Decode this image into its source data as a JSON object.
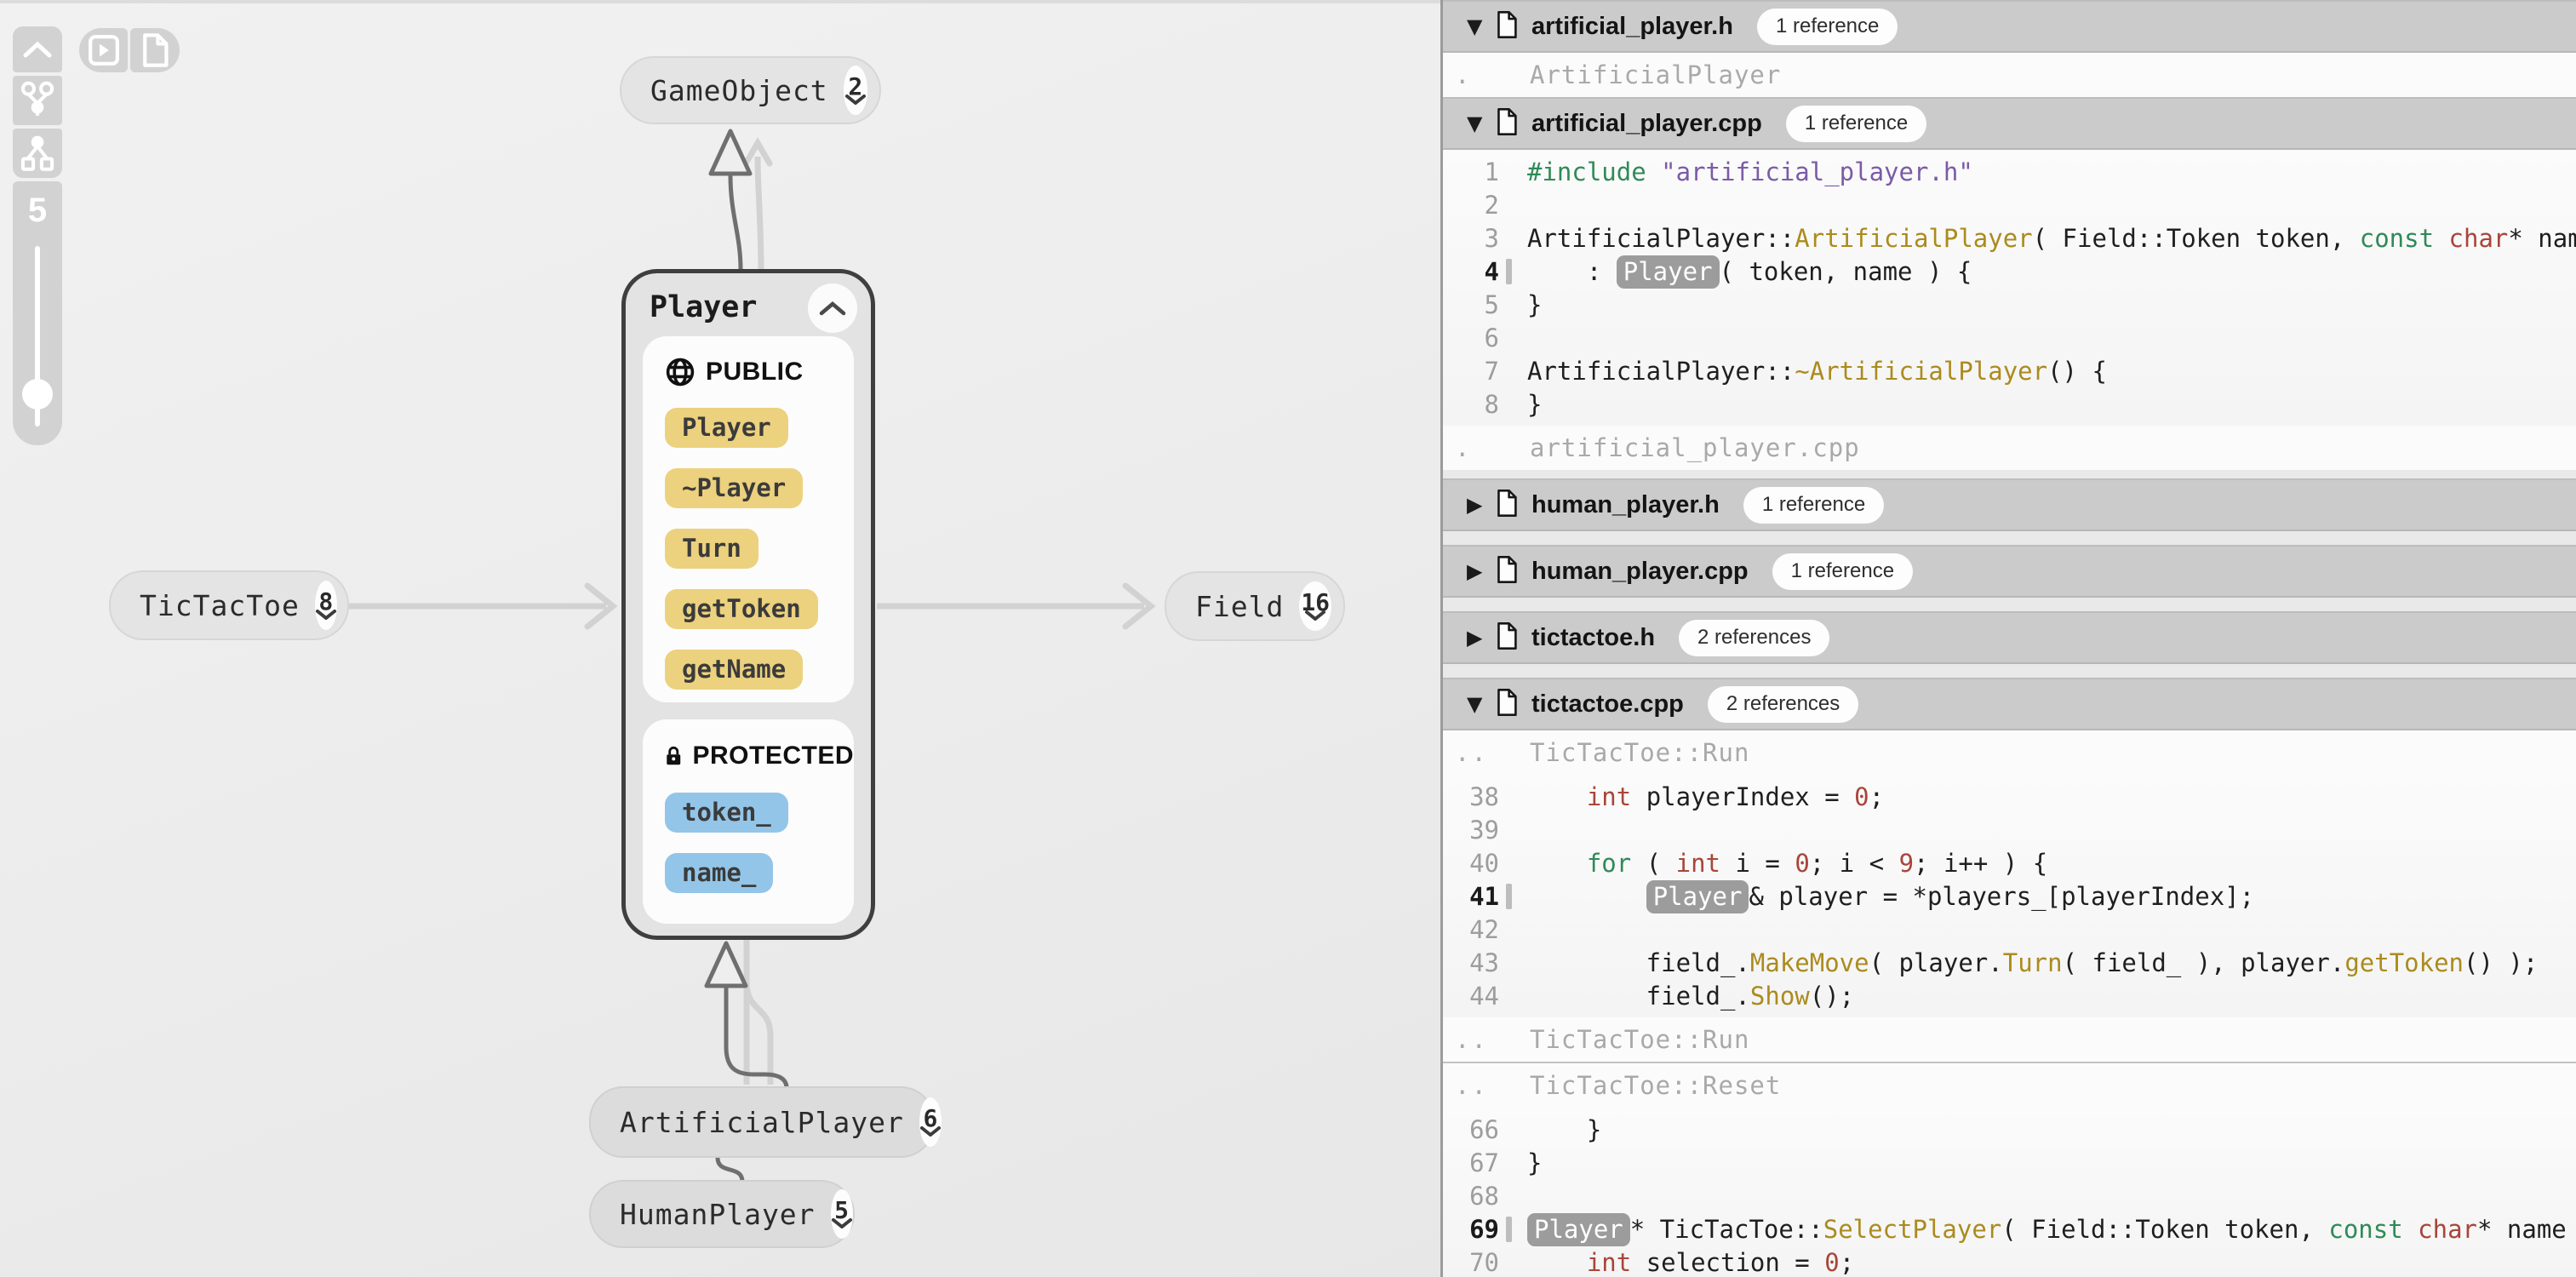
{
  "toolbar": {
    "slider_value": "5",
    "collapse_graph_tooltip": "collapse-all",
    "buttons": [
      "graph-collapse",
      "graph-view",
      "hierarchy-view",
      "custom-trail",
      "file-trail"
    ]
  },
  "colors": {
    "kw": "#2f8a57",
    "ty": "#a8453a",
    "str": "#7b5ba6",
    "fn": "#ab8b1e",
    "num": "#a8453a",
    "p": "#1f1f1f",
    "hl_bg": "#9c9c9c",
    "yellow_pill": "#ecd17e",
    "blue_pill": "#93c5e8",
    "edge_light": "#d2d2d2",
    "edge_dark": "#6f6f6f",
    "header_row": "#cbcbcb"
  },
  "graph": {
    "nodes": {
      "game_object": {
        "label": "GameObject",
        "count": "2"
      },
      "tictactoe": {
        "label": "TicTacToe",
        "count": "8"
      },
      "field": {
        "label": "Field",
        "count": "16"
      },
      "artificial_player": {
        "label": "ArtificialPlayer",
        "count": "6"
      },
      "human_player": {
        "label": "HumanPlayer",
        "count": "5"
      },
      "player": {
        "label": "Player",
        "sections": [
          {
            "icon": "globe",
            "heading": "PUBLIC",
            "pill_color": "#ecd17e",
            "members": [
              "Player",
              "~Player",
              "Turn",
              "getToken",
              "getName"
            ]
          },
          {
            "icon": "lock",
            "heading": "PROTECTED",
            "pill_color": "#93c5e8",
            "members": [
              "token_",
              "name_"
            ]
          }
        ]
      }
    }
  },
  "code_panel": {
    "sections": [
      {
        "type": "file",
        "name": "artificial_player.h",
        "badge": "1 reference",
        "expanded": true,
        "gap": ""
      },
      {
        "type": "scope",
        "marker": ".",
        "text": "ArtificialPlayer"
      },
      {
        "type": "file",
        "name": "artificial_player.cpp",
        "badge": "1 reference",
        "expanded": true,
        "gap": ""
      },
      {
        "type": "code",
        "lines": [
          {
            "num": "1",
            "tokens": [
              {
                "t": "#include",
                "c": "kw"
              },
              {
                "t": " ",
                "c": "p"
              },
              {
                "t": "\"artificial_player.h\"",
                "c": "str"
              }
            ]
          },
          {
            "num": "2",
            "tokens": []
          },
          {
            "num": "3",
            "tokens": [
              {
                "t": "ArtificialPlayer::",
                "c": "p"
              },
              {
                "t": "ArtificialPlayer",
                "c": "fn"
              },
              {
                "t": "( Field::Token token, ",
                "c": "p"
              },
              {
                "t": "const",
                "c": "kw"
              },
              {
                "t": " ",
                "c": "p"
              },
              {
                "t": "char",
                "c": "ty"
              },
              {
                "t": "* name",
                "c": "p"
              }
            ]
          },
          {
            "num": "4",
            "active": true,
            "tokens": [
              {
                "t": "    : ",
                "c": "p"
              },
              {
                "t": "Player",
                "c": "hl"
              },
              {
                "t": "( token, name ) {",
                "c": "p"
              }
            ]
          },
          {
            "num": "5",
            "tokens": [
              {
                "t": "}",
                "c": "p"
              }
            ]
          },
          {
            "num": "6",
            "tokens": []
          },
          {
            "num": "7",
            "tokens": [
              {
                "t": "ArtificialPlayer::",
                "c": "p"
              },
              {
                "t": "~ArtificialPlayer",
                "c": "fn"
              },
              {
                "t": "() {",
                "c": "p"
              }
            ]
          },
          {
            "num": "8",
            "tokens": [
              {
                "t": "}",
                "c": "p"
              }
            ]
          }
        ]
      },
      {
        "type": "scope",
        "marker": ".",
        "text": "artificial_player.cpp"
      },
      {
        "type": "file",
        "name": "human_player.h",
        "badge": "1 reference",
        "expanded": false,
        "gap": "gap10"
      },
      {
        "type": "file",
        "name": "human_player.cpp",
        "badge": "1 reference",
        "expanded": false,
        "gap": "gap16"
      },
      {
        "type": "file",
        "name": "tictactoe.h",
        "badge": "2 references",
        "expanded": false,
        "gap": "gap16"
      },
      {
        "type": "file",
        "name": "tictactoe.cpp",
        "badge": "2 references",
        "expanded": true,
        "gap": "gap16"
      },
      {
        "type": "scope",
        "marker": "..",
        "text": "TicTacToe::Run"
      },
      {
        "type": "code",
        "lines": [
          {
            "num": "38",
            "tokens": [
              {
                "t": "    ",
                "c": "p"
              },
              {
                "t": "int",
                "c": "ty"
              },
              {
                "t": " playerIndex = ",
                "c": "p"
              },
              {
                "t": "0",
                "c": "num"
              },
              {
                "t": ";",
                "c": "p"
              }
            ]
          },
          {
            "num": "39",
            "tokens": []
          },
          {
            "num": "40",
            "tokens": [
              {
                "t": "    ",
                "c": "p"
              },
              {
                "t": "for",
                "c": "kw"
              },
              {
                "t": " ( ",
                "c": "p"
              },
              {
                "t": "int",
                "c": "ty"
              },
              {
                "t": " i = ",
                "c": "p"
              },
              {
                "t": "0",
                "c": "num"
              },
              {
                "t": "; i < ",
                "c": "p"
              },
              {
                "t": "9",
                "c": "num"
              },
              {
                "t": "; i++ ) {",
                "c": "p"
              }
            ]
          },
          {
            "num": "41",
            "active": true,
            "tokens": [
              {
                "t": "        ",
                "c": "p"
              },
              {
                "t": "Player",
                "c": "hl"
              },
              {
                "t": "& player = *players_[playerIndex];",
                "c": "p"
              }
            ]
          },
          {
            "num": "42",
            "tokens": []
          },
          {
            "num": "43",
            "tokens": [
              {
                "t": "        field_.",
                "c": "p"
              },
              {
                "t": "MakeMove",
                "c": "fn"
              },
              {
                "t": "( player.",
                "c": "p"
              },
              {
                "t": "Turn",
                "c": "fn"
              },
              {
                "t": "( field_ ), player.",
                "c": "p"
              },
              {
                "t": "getToken",
                "c": "fn"
              },
              {
                "t": "() );",
                "c": "p"
              }
            ]
          },
          {
            "num": "44",
            "tokens": [
              {
                "t": "        field_.",
                "c": "p"
              },
              {
                "t": "Show",
                "c": "fn"
              },
              {
                "t": "();",
                "c": "p"
              }
            ]
          }
        ]
      },
      {
        "type": "scope",
        "marker": "..",
        "text": "TicTacToe::Run"
      },
      {
        "type": "divider"
      },
      {
        "type": "scope",
        "marker": "..",
        "text": "TicTacToe::Reset"
      },
      {
        "type": "code",
        "lines": [
          {
            "num": "66",
            "tokens": [
              {
                "t": "    }",
                "c": "p"
              }
            ]
          },
          {
            "num": "67",
            "tokens": [
              {
                "t": "}",
                "c": "p"
              }
            ]
          },
          {
            "num": "68",
            "tokens": []
          },
          {
            "num": "69",
            "active": true,
            "tokens": [
              {
                "t": "Player",
                "c": "hl"
              },
              {
                "t": "* TicTacToe::",
                "c": "p"
              },
              {
                "t": "SelectPlayer",
                "c": "fn"
              },
              {
                "t": "( Field::Token token, ",
                "c": "p"
              },
              {
                "t": "const",
                "c": "kw"
              },
              {
                "t": " ",
                "c": "p"
              },
              {
                "t": "char",
                "c": "ty"
              },
              {
                "t": "* name",
                "c": "p"
              }
            ]
          },
          {
            "num": "70",
            "tokens": [
              {
                "t": "    ",
                "c": "p"
              },
              {
                "t": "int",
                "c": "ty"
              },
              {
                "t": " selection = ",
                "c": "p"
              },
              {
                "t": "0",
                "c": "num"
              },
              {
                "t": ";",
                "c": "p"
              }
            ]
          }
        ]
      }
    ]
  }
}
